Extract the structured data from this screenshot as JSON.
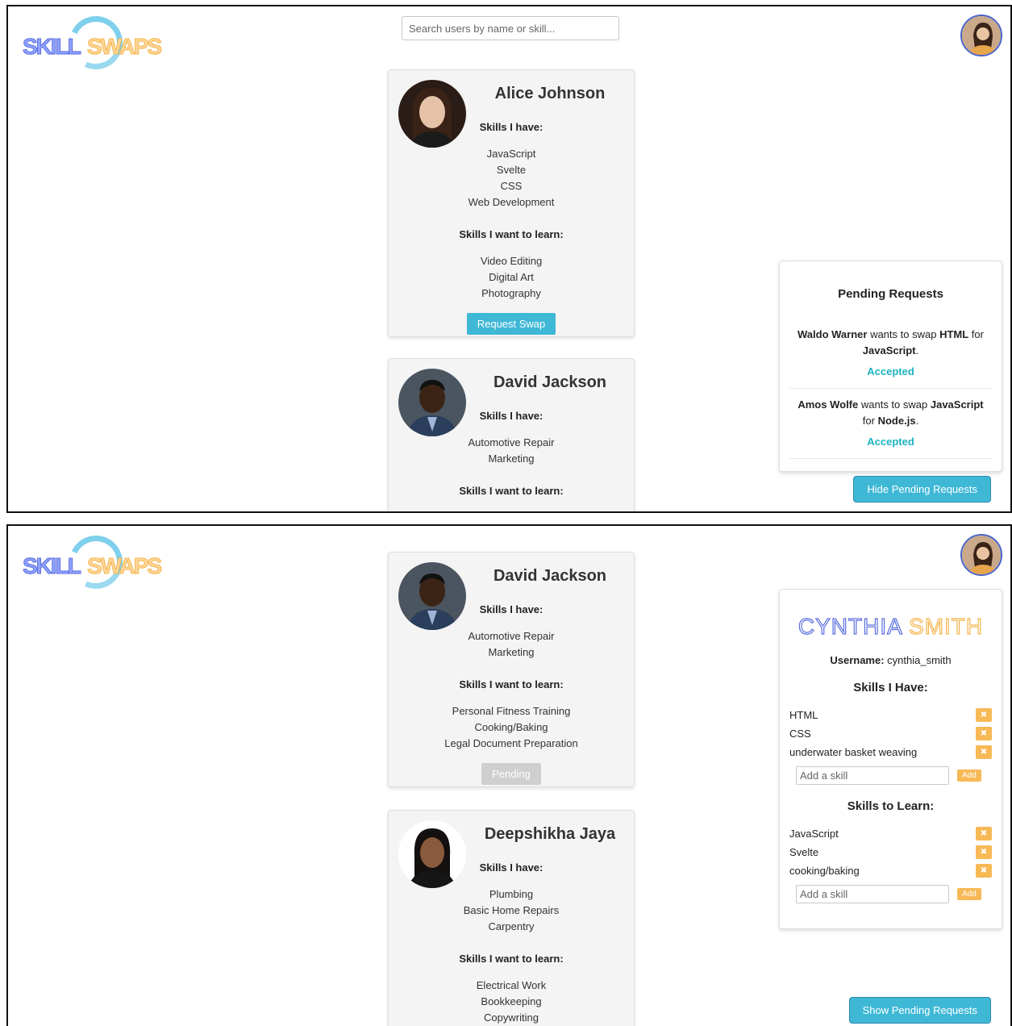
{
  "logo": {
    "word1": "SKILL",
    "word2": "SWAPS"
  },
  "search": {
    "placeholder": "Search users by name or skill..."
  },
  "labels": {
    "skills_have": "Skills I have:",
    "skills_learn": "Skills I want to learn:"
  },
  "users": [
    {
      "name": "Alice Johnson",
      "have": [
        "JavaScript",
        "Svelte",
        "CSS",
        "Web Development"
      ],
      "learn": [
        "Video Editing",
        "Digital Art",
        "Photography"
      ],
      "action": "Request Swap"
    },
    {
      "name": "David Jackson",
      "have": [
        "Automotive Repair",
        "Marketing"
      ],
      "learn": [
        "Personal Fitness Training",
        "Cooking/Baking",
        "Legal Document Preparation"
      ],
      "action": "Pending"
    },
    {
      "name": "Deepshikha Jaya",
      "have": [
        "Plumbing",
        "Basic Home Repairs",
        "Carpentry"
      ],
      "learn": [
        "Electrical Work",
        "Bookkeeping",
        "Copywriting"
      ]
    }
  ],
  "pending": {
    "title": "Pending Requests",
    "requests": [
      {
        "from": "Waldo Warner",
        "mid": " wants to swap ",
        "give": "HTML",
        "for": " for ",
        "get": "JavaScript",
        "end": ".",
        "status": "Accepted"
      },
      {
        "from": "Amos Wolfe",
        "mid": " wants to swap ",
        "give": "JavaScript",
        "for": " for ",
        "get": "Node.js",
        "end": ".",
        "status": "Accepted"
      }
    ],
    "hide_label": "Hide Pending Requests",
    "show_label": "Show Pending Requests"
  },
  "profile": {
    "first": "CYNTHIA",
    "last": "SMITH",
    "username_label": "Username:",
    "username": "cynthia_smith",
    "have_title": "Skills I Have:",
    "have": [
      "HTML",
      "CSS",
      "underwater basket weaving"
    ],
    "learn_title": "Skills to Learn:",
    "learn": [
      "JavaScript",
      "Svelte",
      "cooking/baking"
    ],
    "add_placeholder": "Add a skill",
    "add_label": "Add",
    "remove_glyph": "✖"
  }
}
